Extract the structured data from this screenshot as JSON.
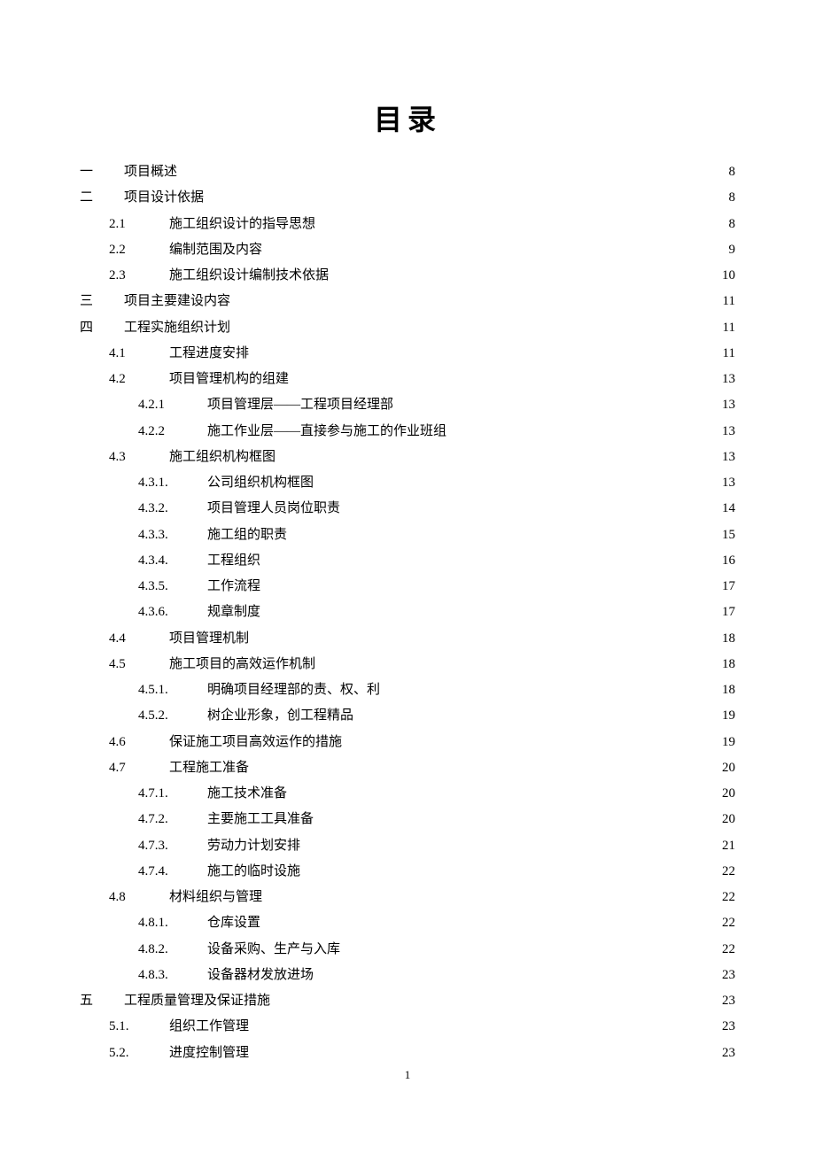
{
  "title": "目录",
  "page_number": "1",
  "toc": [
    {
      "level": 0,
      "number": "一",
      "label": "项目概述",
      "page": "8",
      "interactable": true
    },
    {
      "level": 0,
      "number": "二",
      "label": "项目设计依据",
      "page": "8",
      "interactable": true
    },
    {
      "level": 1,
      "number": "2.1",
      "label": "施工组织设计的指导思想",
      "page": "8",
      "interactable": true
    },
    {
      "level": 1,
      "number": "2.2",
      "label": "编制范围及内容",
      "page": "9",
      "interactable": true
    },
    {
      "level": 1,
      "number": "2.3",
      "label": "施工组织设计编制技术依据",
      "page": "10",
      "interactable": true
    },
    {
      "level": 0,
      "number": "三",
      "label": "项目主要建设内容",
      "page": "11",
      "interactable": true
    },
    {
      "level": 0,
      "number": "四",
      "label": "工程实施组织计划",
      "page": "11",
      "interactable": true
    },
    {
      "level": 1,
      "number": "4.1",
      "label": "工程进度安排",
      "page": "11",
      "interactable": true
    },
    {
      "level": 1,
      "number": "4.2",
      "label": "项目管理机构的组建",
      "page": "13",
      "interactable": true
    },
    {
      "level": 2,
      "number": "4.2.1",
      "label": "项目管理层——工程项目经理部",
      "page": "13",
      "interactable": true
    },
    {
      "level": 2,
      "number": "4.2.2",
      "label": "施工作业层——直接参与施工的作业班组",
      "page": "13",
      "interactable": true
    },
    {
      "level": 1,
      "number": "4.3",
      "label": "施工组织机构框图",
      "page": "13",
      "interactable": true
    },
    {
      "level": 2,
      "number": "4.3.1.",
      "label": "公司组织机构框图",
      "page": "13",
      "interactable": true
    },
    {
      "level": 2,
      "number": "4.3.2.",
      "label": "项目管理人员岗位职责",
      "page": "14",
      "interactable": true
    },
    {
      "level": 2,
      "number": "4.3.3.",
      "label": "施工组的职责",
      "page": "15",
      "interactable": true
    },
    {
      "level": 2,
      "number": "4.3.4.",
      "label": "工程组织",
      "page": "16",
      "interactable": true
    },
    {
      "level": 2,
      "number": "4.3.5.",
      "label": "工作流程",
      "page": "17",
      "interactable": true
    },
    {
      "level": 2,
      "number": "4.3.6.",
      "label": "规章制度",
      "page": "17",
      "interactable": true
    },
    {
      "level": 1,
      "number": "4.4",
      "label": "项目管理机制",
      "page": "18",
      "interactable": true
    },
    {
      "level": 1,
      "number": "4.5",
      "label": "施工项目的高效运作机制",
      "page": "18",
      "interactable": true
    },
    {
      "level": 2,
      "number": "4.5.1.",
      "label": "明确项目经理部的责、权、利",
      "page": "18",
      "interactable": true
    },
    {
      "level": 2,
      "number": "4.5.2.",
      "label": "树企业形象，创工程精品",
      "page": "19",
      "interactable": true
    },
    {
      "level": 1,
      "number": "4.6",
      "label": "保证施工项目高效运作的措施",
      "page": "19",
      "interactable": true
    },
    {
      "level": 1,
      "number": "4.7",
      "label": "工程施工准备",
      "page": "20",
      "interactable": true
    },
    {
      "level": 2,
      "number": "4.7.1.",
      "label": "施工技术准备",
      "page": "20",
      "interactable": true
    },
    {
      "level": 2,
      "number": "4.7.2.",
      "label": "主要施工工具准备",
      "page": "20",
      "interactable": true
    },
    {
      "level": 2,
      "number": "4.7.3.",
      "label": "劳动力计划安排",
      "page": "21",
      "interactable": true
    },
    {
      "level": 2,
      "number": "4.7.4.",
      "label": "施工的临时设施",
      "page": "22",
      "interactable": true
    },
    {
      "level": 1,
      "number": "4.8",
      "label": "材料组织与管理",
      "page": "22",
      "interactable": true
    },
    {
      "level": 2,
      "number": "4.8.1.",
      "label": "仓库设置",
      "page": "22",
      "interactable": true
    },
    {
      "level": 2,
      "number": "4.8.2.",
      "label": "设备采购、生产与入库",
      "page": "22",
      "interactable": true
    },
    {
      "level": 2,
      "number": "4.8.3.",
      "label": "设备器材发放进场",
      "page": "23",
      "interactable": true
    },
    {
      "level": 0,
      "number": "五",
      "label": "工程质量管理及保证措施",
      "page": "23",
      "interactable": true
    },
    {
      "level": 1,
      "number": "5.1.",
      "label": "组织工作管理",
      "page": "23",
      "interactable": true
    },
    {
      "level": 1,
      "number": "5.2.",
      "label": "进度控制管理",
      "page": "23",
      "interactable": true
    }
  ]
}
